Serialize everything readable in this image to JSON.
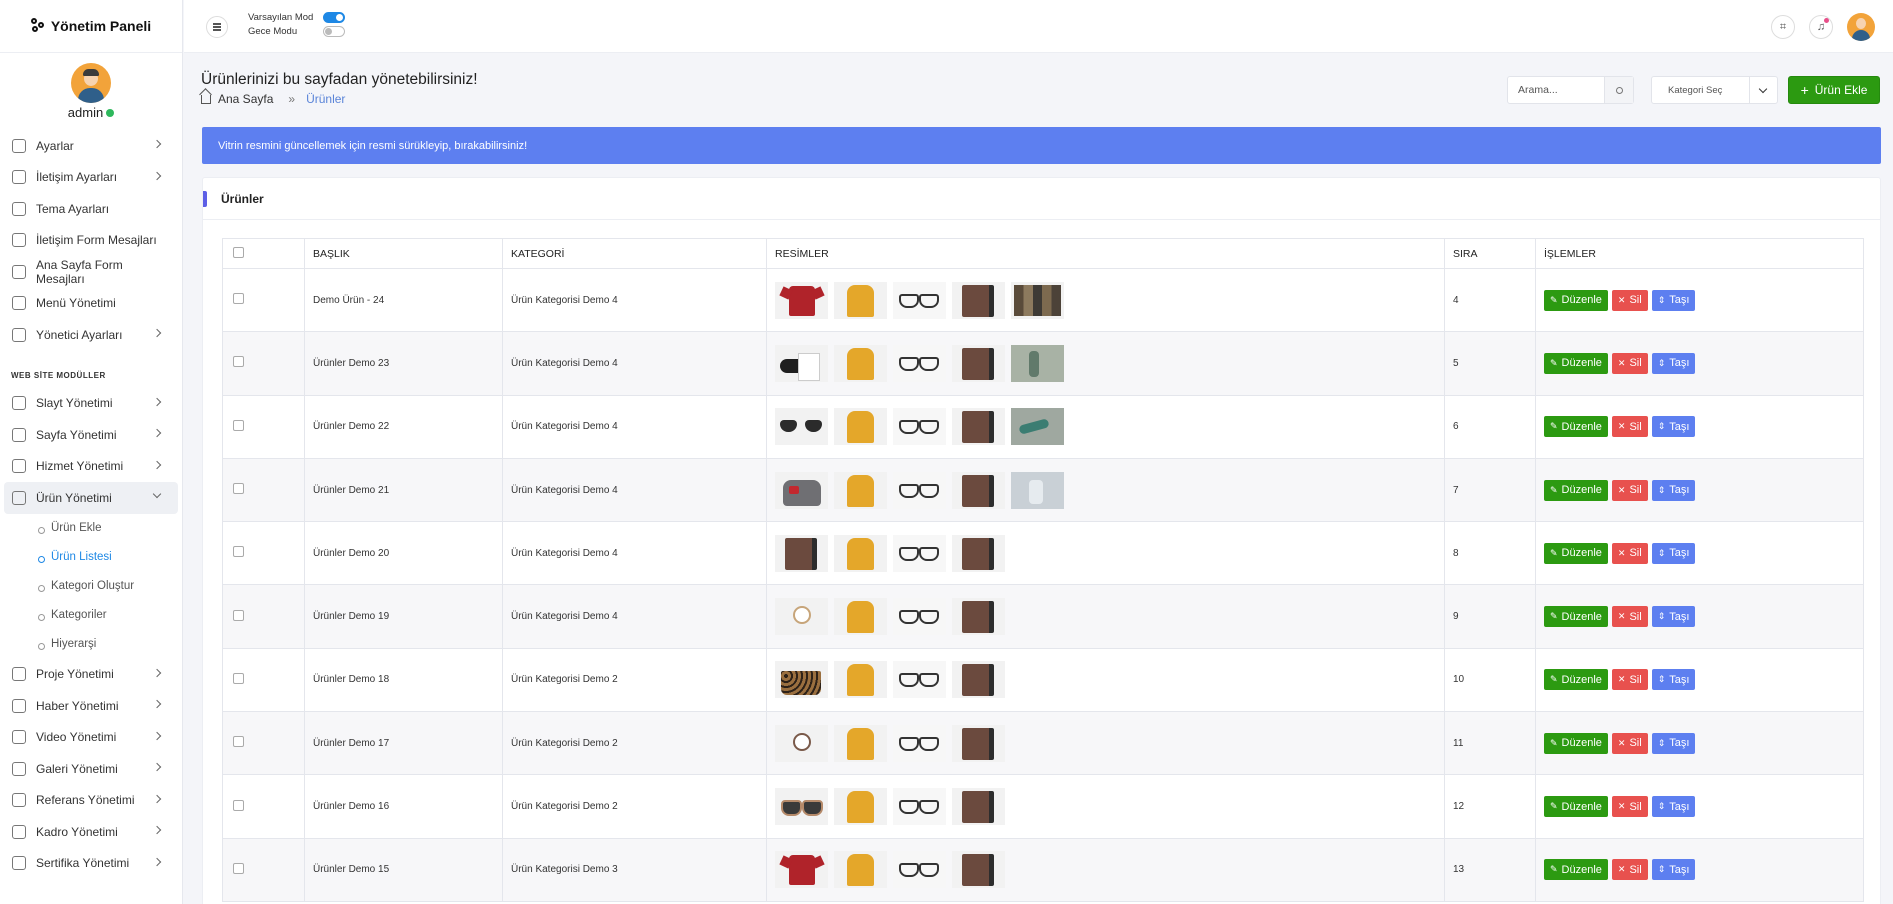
{
  "app": {
    "title": "Yönetim Paneli"
  },
  "user": {
    "name": "admin"
  },
  "topbar": {
    "modes": [
      {
        "label": "Varsayılan Mod",
        "on": true
      },
      {
        "label": "Gece Modu",
        "on": false
      }
    ]
  },
  "sidebar": {
    "items_top": [
      {
        "label": "Ayarlar",
        "icon": "gear-icon",
        "chevron": true
      },
      {
        "label": "İletişim Ayarları",
        "icon": "map-pin-icon",
        "chevron": true
      },
      {
        "label": "Tema Ayarları",
        "icon": "palette-icon",
        "chevron": false
      },
      {
        "label": "İletişim Form Mesajları",
        "icon": "mail-icon",
        "chevron": false
      },
      {
        "label": "Ana Sayfa Form Mesajları",
        "icon": "mail-icon",
        "chevron": false
      },
      {
        "label": "Menü Yönetimi",
        "icon": "sitemap-icon",
        "chevron": false
      },
      {
        "label": "Yönetici Ayarları",
        "icon": "users-icon",
        "chevron": true
      }
    ],
    "section_label": "WEB SİTE MODÜLLER",
    "items_modules": [
      {
        "label": "Slayt Yönetimi",
        "icon": "image-icon"
      },
      {
        "label": "Sayfa Yönetimi",
        "icon": "file-icon"
      },
      {
        "label": "Hizmet Yönetimi",
        "icon": "briefcase-icon"
      }
    ],
    "open_item": {
      "label": "Ürün Yönetimi",
      "icon": "box-icon"
    },
    "sub_items": [
      {
        "label": "Ürün Ekle",
        "active": false
      },
      {
        "label": "Ürün Listesi",
        "active": true
      },
      {
        "label": "Kategori Oluştur",
        "active": false
      },
      {
        "label": "Kategoriler",
        "active": false
      },
      {
        "label": "Hiyerarşi",
        "active": false
      }
    ],
    "items_bottom": [
      {
        "label": "Proje Yönetimi",
        "icon": "tools-icon"
      },
      {
        "label": "Haber Yönetimi",
        "icon": "newspaper-icon"
      },
      {
        "label": "Video Yönetimi",
        "icon": "video-icon"
      },
      {
        "label": "Galeri Yönetimi",
        "icon": "gallery-icon"
      },
      {
        "label": "Referans Yönetimi",
        "icon": "list-icon"
      },
      {
        "label": "Kadro Yönetimi",
        "icon": "team-icon"
      },
      {
        "label": "Sertifika Yönetimi",
        "icon": "award-icon"
      }
    ]
  },
  "page": {
    "title": "Ürünlerinizi bu sayfadan yönetebilirsiniz!",
    "breadcrumb": {
      "home": "Ana Sayfa",
      "sep": "»",
      "current": "Ürünler"
    },
    "search_placeholder": "Arama...",
    "category_select": "Kategori Seç",
    "add_button": "Ürün Ekle",
    "alert": "Vitrin resmini güncellemek için resmi sürükleyip, bırakabilirsiniz!",
    "card_title": "Ürünler"
  },
  "table": {
    "columns": [
      "",
      "BAŞLIK",
      "KATEGORİ",
      "RESİMLER",
      "SIRA",
      "İŞLEMLER"
    ],
    "actions": {
      "edit": "Düzenle",
      "delete": "Sil",
      "move": "Taşı"
    },
    "rows": [
      {
        "title": "Demo Ürün - 24",
        "category": "Ürün Kategorisi Demo 4",
        "order": "4",
        "images": [
          "t-shirt",
          "t-hoodie",
          "t-glasses",
          "t-wallet",
          "t-bottles"
        ]
      },
      {
        "title": "Ürünler Demo 23",
        "category": "Ürün Kategorisi Demo 4",
        "order": "5",
        "images": [
          "t-cap",
          "t-hoodie",
          "t-glasses",
          "t-wallet",
          "t-vase"
        ]
      },
      {
        "title": "Ürünler Demo 22",
        "category": "Ürün Kategorisi Demo 4",
        "order": "6",
        "images": [
          "t-sunglass",
          "t-hoodie",
          "t-glasses",
          "t-wallet",
          "t-teal"
        ]
      },
      {
        "title": "Ürünler Demo 21",
        "category": "Ürün Kategorisi Demo 4",
        "order": "7",
        "images": [
          "t-bag",
          "t-hoodie",
          "t-glasses",
          "t-wallet",
          "t-perfume"
        ]
      },
      {
        "title": "Ürünler Demo 20",
        "category": "Ürün Kategorisi Demo 4",
        "order": "8",
        "images": [
          "t-wallet",
          "t-hoodie",
          "t-glasses",
          "t-wallet"
        ]
      },
      {
        "title": "Ürünler Demo 19",
        "category": "Ürün Kategorisi Demo 4",
        "order": "9",
        "images": [
          "t-watch",
          "t-hoodie",
          "t-glasses",
          "t-wallet"
        ]
      },
      {
        "title": "Ürünler Demo 18",
        "category": "Ürün Kategorisi Demo 2",
        "order": "10",
        "images": [
          "t-leopard",
          "t-hoodie",
          "t-glasses",
          "t-wallet"
        ]
      },
      {
        "title": "Ürünler Demo 17",
        "category": "Ürün Kategorisi Demo 2",
        "order": "11",
        "images": [
          "t-watch2",
          "t-hoodie",
          "t-glasses",
          "t-wallet"
        ]
      },
      {
        "title": "Ürünler Demo 16",
        "category": "Ürün Kategorisi Demo 2",
        "order": "12",
        "images": [
          "t-pattern",
          "t-hoodie",
          "t-glasses",
          "t-wallet"
        ]
      },
      {
        "title": "Ürünler Demo 15",
        "category": "Ürün Kategorisi Demo 3",
        "order": "13",
        "images": [
          "t-shirt",
          "t-hoodie",
          "t-glasses",
          "t-wallet"
        ]
      }
    ]
  }
}
